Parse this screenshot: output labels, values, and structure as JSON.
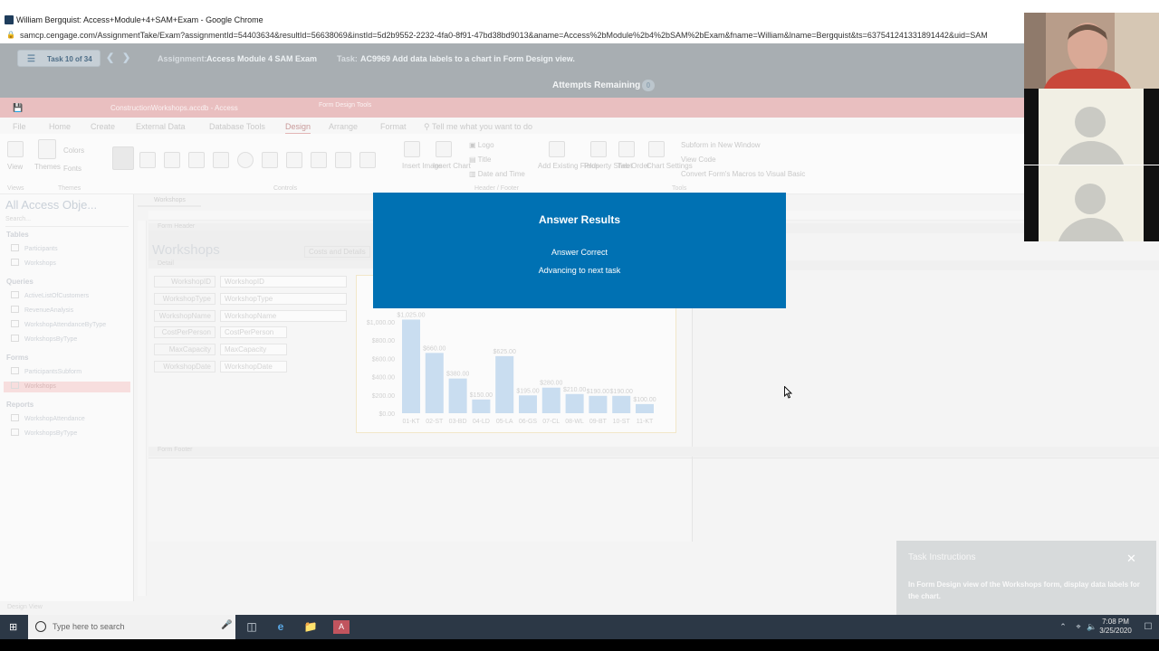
{
  "browser": {
    "window_title": "William Bergquist: Access+Module+4+SAM+Exam - Google Chrome",
    "url": "samcp.cengage.com/AssignmentTake/Exam?assignmentId=54403634&resultId=56638069&instId=5d2b9552-2232-4fa0-8f91-47bd38bd9013&aname=Access%2bModule%2b4%2bSAM%2bExam&fname=William&lname=Bergquist&ts=637541241331891442&uid=SAM"
  },
  "sam_header": {
    "task_counter": "Task 10 of 34",
    "assignment_label": "Assignment:",
    "assignment_value": "Access Module 4 SAM Exam",
    "task_label": "Task:",
    "task_value": "AC9969 Add data labels to a chart in Form Design view.",
    "attempts_label": "Attempts Remaining",
    "attempts_count": "0"
  },
  "access": {
    "file_title": "ConstructionWorkshops.accdb - Access",
    "context_title": "Form Design Tools",
    "tabs": [
      "File",
      "Home",
      "Create",
      "External Data",
      "Database Tools",
      "Design",
      "Arrange",
      "Format"
    ],
    "active_tab": "Design",
    "tell_me": "Tell me what you want to do",
    "ribbon": {
      "view": "View",
      "themes": "Themes",
      "colors": "Colors",
      "fonts": "Fonts",
      "insert_image": "Insert Image",
      "insert_chart": "Insert Chart",
      "logo": "Logo",
      "title": "Title",
      "date_time": "Date and Time",
      "add_existing_fields": "Add Existing Fields",
      "property_sheet": "Property Sheet",
      "tab_order": "Tab Order",
      "chart_settings": "Chart Settings",
      "subform_new_window": "Subform in New Window",
      "view_code": "View Code",
      "convert_macros": "Convert Form's Macros to Visual Basic",
      "groups": [
        "Views",
        "Themes",
        "Controls",
        "Header / Footer",
        "Tools"
      ]
    },
    "nav_pane": {
      "header": "All Access Obje...",
      "search_placeholder": "Search...",
      "sections": [
        {
          "name": "Tables",
          "items": [
            "Participants",
            "Workshops"
          ]
        },
        {
          "name": "Queries",
          "items": [
            "ActiveListOfCustomers",
            "RevenueAnalysis",
            "WorkshopAttendanceByType",
            "WorkshopsByType"
          ]
        },
        {
          "name": "Forms",
          "items": [
            "ParticipantsSubform",
            "Workshops"
          ]
        },
        {
          "name": "Reports",
          "items": [
            "WorkshopAttendance",
            "WorkshopsByType"
          ]
        }
      ],
      "selected_item": "Workshops"
    },
    "document_tab": "Workshops",
    "sections": {
      "form_header": "Form Header",
      "detail": "Detail",
      "form_footer": "Form Footer"
    },
    "form_title": "Workshops",
    "cost_label": "Costs and Details",
    "fields": [
      {
        "label": "WorkshopID",
        "control": "WorkshopID"
      },
      {
        "label": "WorkshopType",
        "control": "WorkshopType"
      },
      {
        "label": "WorkshopName",
        "control": "WorkshopName"
      },
      {
        "label": "CostPerPerson",
        "control": "CostPerPerson"
      },
      {
        "label": "MaxCapacity",
        "control": "MaxCapacity"
      },
      {
        "label": "WorkshopDate",
        "control": "WorkshopDate"
      }
    ],
    "status_text": "Design View"
  },
  "chart_data": {
    "type": "bar",
    "categories": [
      "01-KT",
      "02-ST",
      "03-BD",
      "04-LD",
      "05-LA",
      "06-GS",
      "07-CL",
      "08-WL",
      "09-BT",
      "10-ST",
      "11-KT"
    ],
    "values": [
      1025,
      660,
      380,
      150,
      625,
      195,
      280,
      210,
      190,
      190,
      100
    ],
    "data_labels": [
      "$1,025.00",
      "$660.00",
      "$380.00",
      "$150.00",
      "$625.00",
      "$195.00",
      "$280.00",
      "$210.00",
      "$190.00",
      "$190.00",
      "$100.00"
    ],
    "y_ticks": [
      "$0.00",
      "$200.00",
      "$400.00",
      "$600.00",
      "$800.00",
      "$1,000.00"
    ],
    "ylim": [
      0,
      1100
    ],
    "color": "#c9ddf0"
  },
  "modal": {
    "title": "Answer Results",
    "line1": "Answer Correct",
    "line2": "Advancing to next task",
    "bg": "#0071b3"
  },
  "task_panel": {
    "title": "Task Instructions",
    "close": "✕",
    "body": "In Form Design view of the Workshops form, display data labels for the chart."
  },
  "taskbar": {
    "search_placeholder": "Type here to search",
    "time": "7:08 PM",
    "date": "3/25/2020"
  }
}
